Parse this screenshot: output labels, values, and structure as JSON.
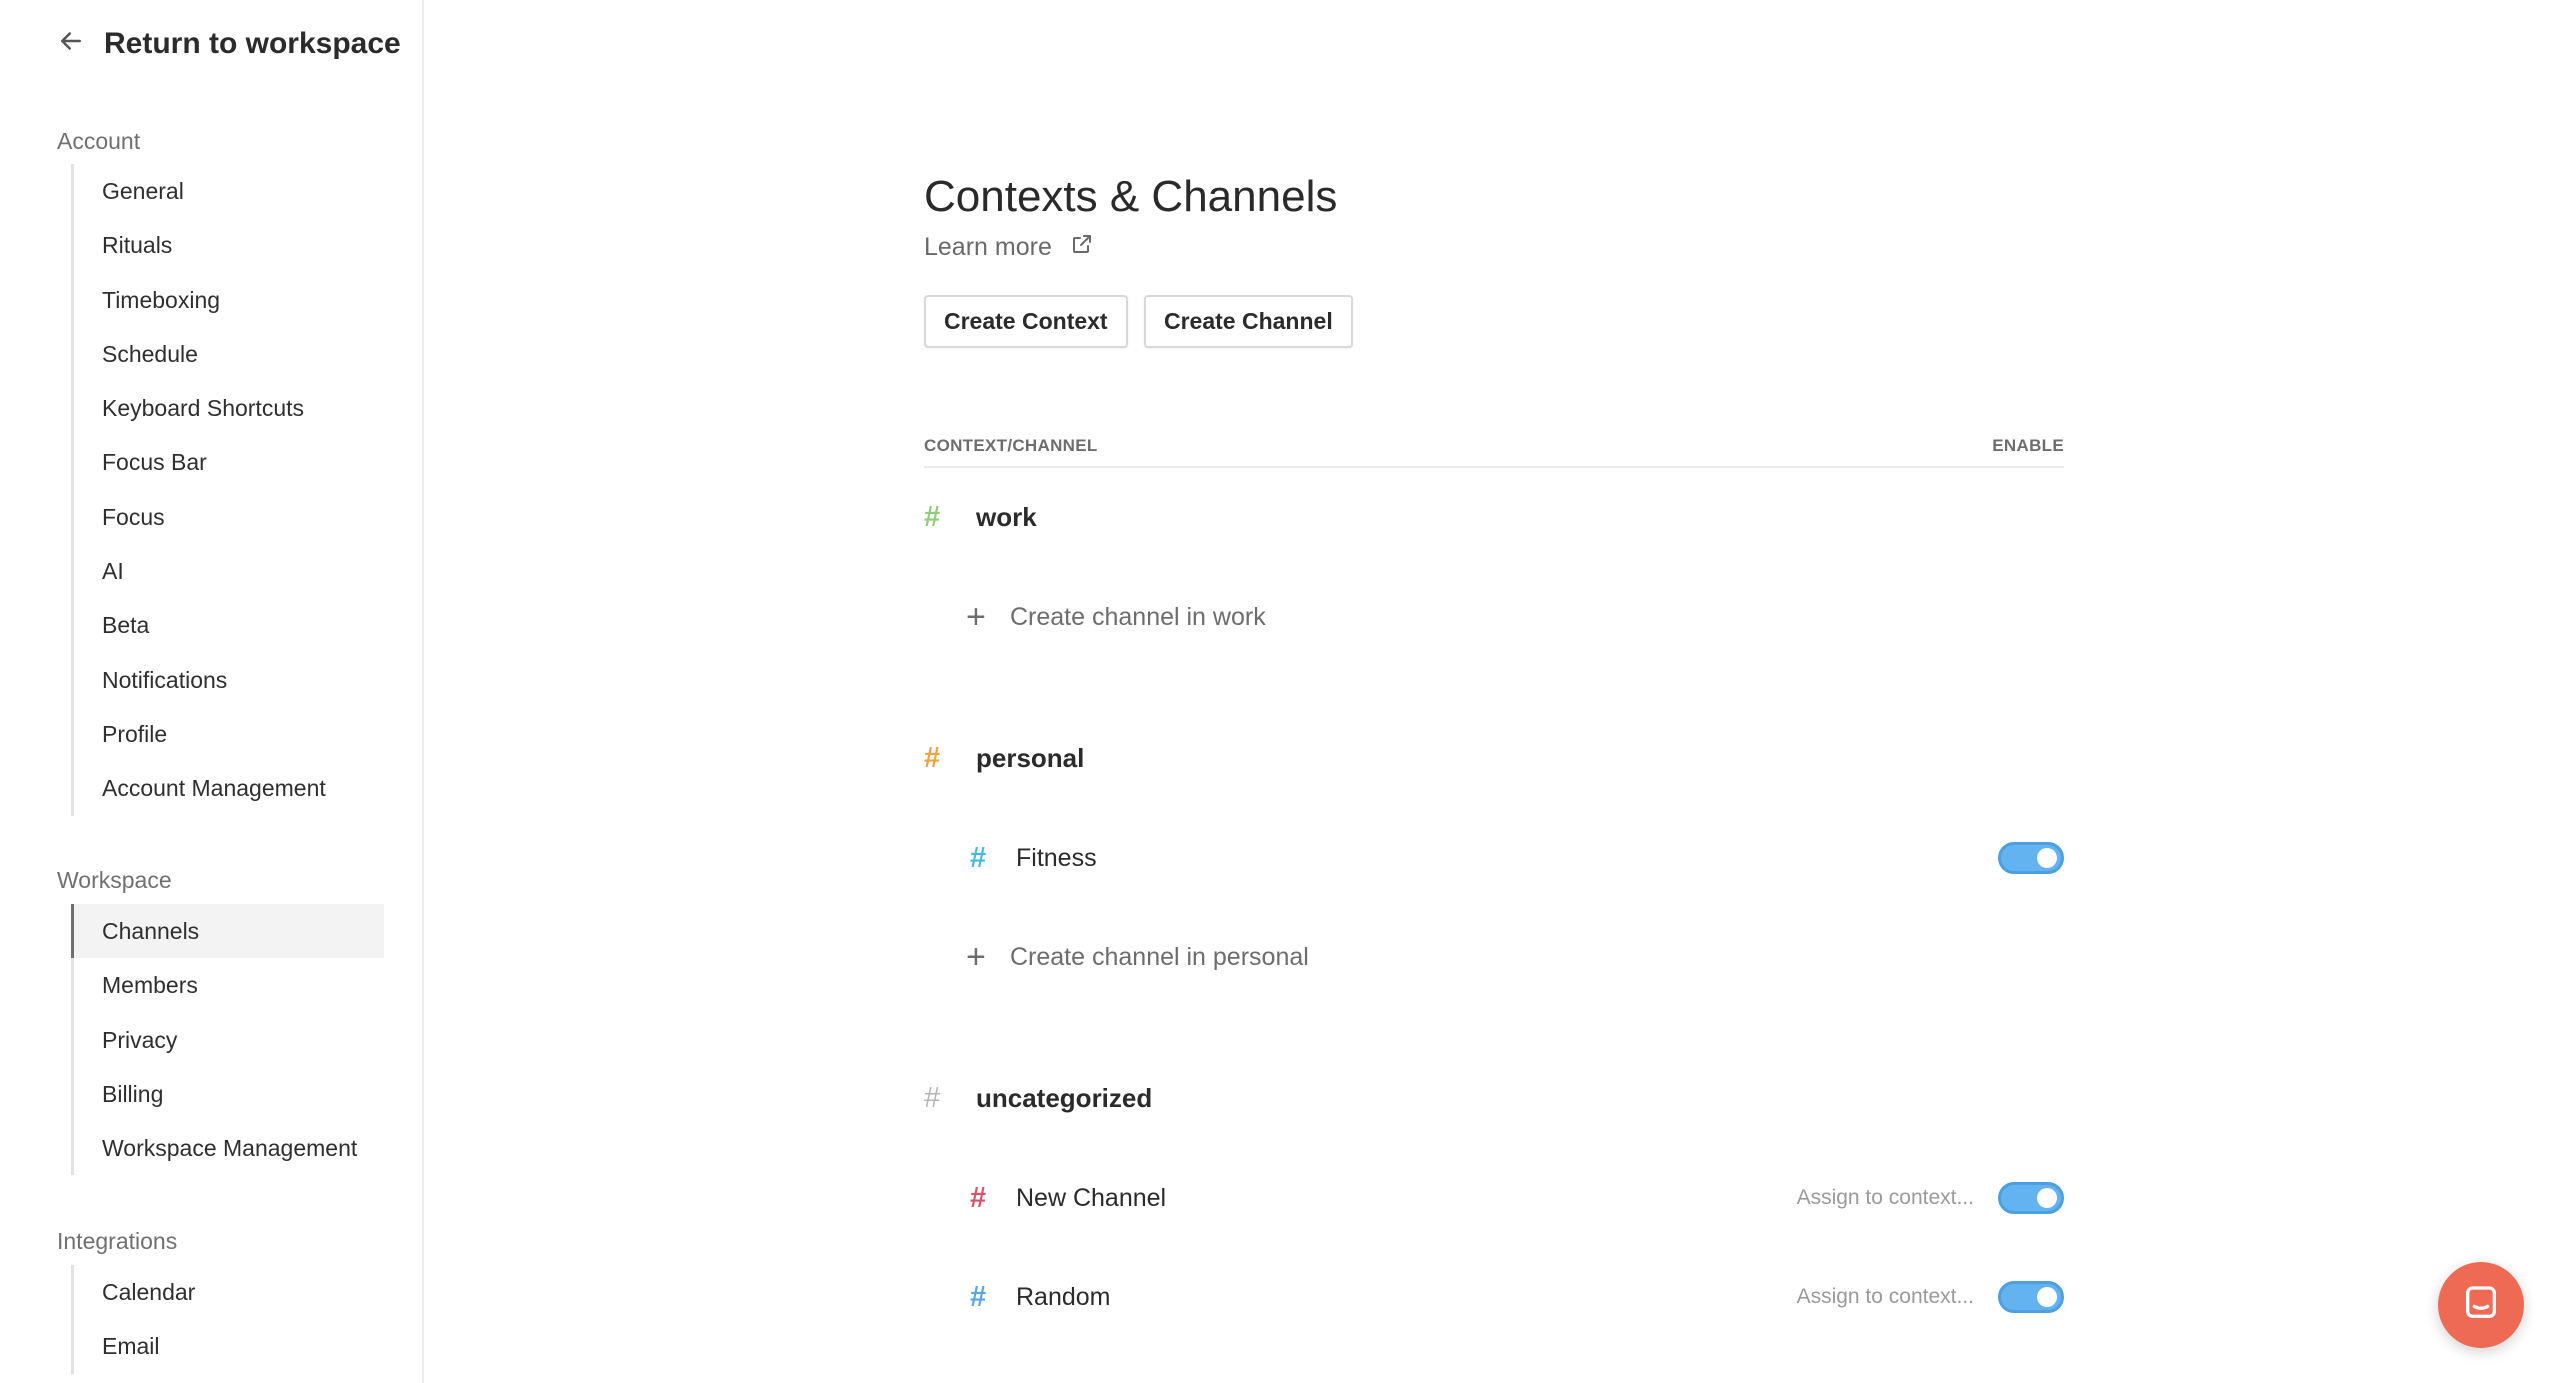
{
  "sidebar": {
    "back_label": "Return to workspace",
    "sections": [
      {
        "title": "Account",
        "items": [
          "General",
          "Rituals",
          "Timeboxing",
          "Schedule",
          "Keyboard Shortcuts",
          "Focus Bar",
          "Focus",
          "AI",
          "Beta",
          "Notifications",
          "Profile",
          "Account Management"
        ]
      },
      {
        "title": "Workspace",
        "items": [
          "Channels",
          "Members",
          "Privacy",
          "Billing",
          "Workspace Management"
        ],
        "active": "Channels"
      },
      {
        "title": "Integrations",
        "items": [
          "Calendar",
          "Email"
        ]
      }
    ]
  },
  "main": {
    "title": "Contexts & Channels",
    "learn_more": "Learn more",
    "create_context": "Create Context",
    "create_channel": "Create Channel",
    "col_context": "CONTEXT/CHANNEL",
    "col_enable": "ENABLE",
    "contexts": [
      {
        "name": "work",
        "hash_color": "#8fce7a",
        "channels": [],
        "create_label": "Create channel in work"
      },
      {
        "name": "personal",
        "hash_color": "#f1a23c",
        "channels": [
          {
            "name": "Fitness",
            "hash_color": "#4cb8d9",
            "enabled": true
          }
        ],
        "create_label": "Create channel in personal"
      },
      {
        "name": "uncategorized",
        "hash_color": "#b5b5b5",
        "channels": [
          {
            "name": "New Channel",
            "hash_color": "#d9546b",
            "enabled": true,
            "assign": "Assign to context..."
          },
          {
            "name": "Random",
            "hash_color": "#5aa6e0",
            "enabled": true,
            "assign": "Assign to context..."
          }
        ]
      }
    ]
  },
  "colors": {
    "toggle_on": "#62b3f0",
    "chat_launcher": "#ee6a55"
  },
  "icons": {
    "back": "arrow-left-icon",
    "external": "external-link-icon",
    "plus": "plus-icon",
    "hash": "hash-icon",
    "chat": "chat-bubble-icon"
  }
}
